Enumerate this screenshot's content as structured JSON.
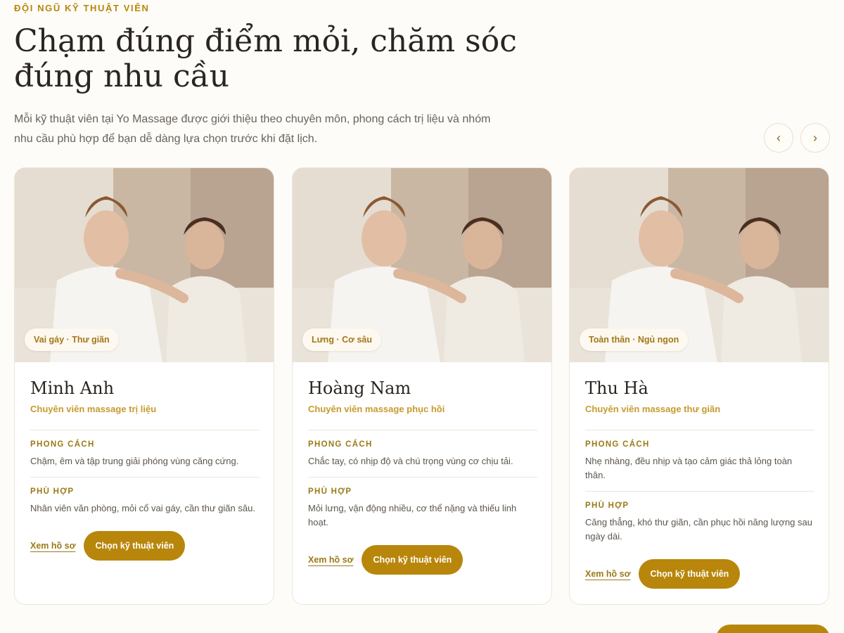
{
  "section": {
    "eyebrow": "ĐỘI NGŨ KỸ THUẬT VIÊN",
    "title": "Chạm đúng điểm mỏi, chăm sóc đúng nhu cầu",
    "intro": "Mỗi kỹ thuật viên tại Yo Massage được giới thiệu theo chuyên môn, phong cách trị liệu và nhóm nhu cầu phù hợp để bạn dễ dàng lựa chọn trước khi đặt lịch."
  },
  "nav": {
    "prev": "‹",
    "next": "›"
  },
  "labels": {
    "style": "PHONG CÁCH",
    "fit": "PHÙ HỢP",
    "view_profile": "Xem hồ sơ",
    "choose": "Chọn kỹ thuật viên"
  },
  "colors": {
    "accent": "#b8860b",
    "role": "#c79a2e",
    "background": "#fdfcf8"
  },
  "cards": [
    {
      "tag": "Vai gáy · Thư giãn",
      "name": "Minh Anh",
      "role": "Chuyên viên massage trị liệu",
      "style": "Chậm, êm và tập trung giải phóng vùng căng cứng.",
      "fit": "Nhân viên văn phòng, mỏi cổ vai gáy, cần thư giãn sâu."
    },
    {
      "tag": "Lưng · Cơ sâu",
      "name": "Hoàng Nam",
      "role": "Chuyên viên massage phục hồi",
      "style": "Chắc tay, có nhịp độ và chú trọng vùng cơ chịu tải.",
      "fit": "Mỏi lưng, vận động nhiều, cơ thể nặng và thiếu linh hoạt."
    },
    {
      "tag": "Toàn thân · Ngủ ngon",
      "name": "Thu Hà",
      "role": "Chuyên viên massage thư giãn",
      "style": "Nhẹ nhàng, đều nhịp và tạo cảm giác thả lỏng toàn thân.",
      "fit": "Căng thẳng, khó thư giãn, cần phục hồi năng lượng sau ngày dài."
    }
  ]
}
